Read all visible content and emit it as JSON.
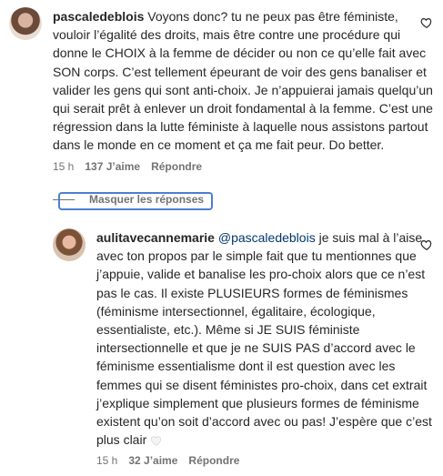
{
  "comments": [
    {
      "username": "pascaledeblois",
      "text": "Voyons donc? tu ne peux pas être féministe, vouloir l’égalité des droits, mais être contre une procédure qui donne le CHOIX à la femme de décider ou non ce qu’elle fait avec SON corps. C’est tellement épeurant de voir des gens banaliser et valider les gens qui sont anti-choix. Je n’appuierai jamais quelqu’un qui serait prêt à enlever un droit fondamental à la femme. C’est une régression dans la lutte féministe à laquelle nous assistons partout dans le monde en ce moment et ça me fait peur. Do better.",
      "time": "15 h",
      "likes": "137 J’aime",
      "reply": "Répondre"
    },
    {
      "username": "aulitavecannemarie",
      "mention": "@pascaledeblois",
      "text": "je suis mal à l’aise avec ton propos par le simple fait que tu mentionnes que j’appuie, valide et banalise les pro-choix alors que ce n’est pas le cas. Il existe PLUSIEURS formes de féminismes (féminisme intersectionnel, égalitaire, écologique, essentialiste, etc.). Même si JE SUIS féministe intersectionnelle et que je ne SUIS PAS d’accord avec le féminisme essentialisme dont il est question avec les femmes qui se disent féministes pro-choix, dans cet extrait j’explique simplement que plusieurs formes de féminisme existent qu’on soit d’accord avec ou pas! J’espère que c’est plus clair",
      "time": "15 h",
      "likes": "32 J’aime",
      "reply": "Répondre"
    }
  ],
  "hide_replies_label": "Masquer les réponses",
  "icons": {
    "like": "heart-outline-icon",
    "emoji": "white-heart-emoji"
  }
}
